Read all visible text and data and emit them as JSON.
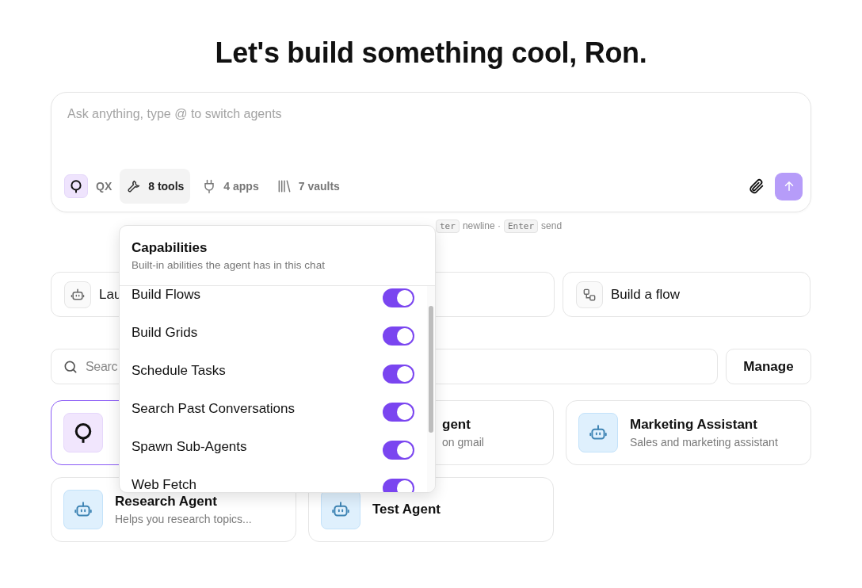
{
  "heading": "Let's build something cool, Ron.",
  "composer": {
    "placeholder": "Ask anything, type @ to switch agents",
    "agent": {
      "label": "QX"
    },
    "chips": [
      {
        "kind": "tools",
        "label": "8 tools",
        "selected": true
      },
      {
        "kind": "apps",
        "label": "4 apps",
        "selected": false
      },
      {
        "kind": "vaults",
        "label": "7 vaults",
        "selected": false
      }
    ],
    "send": {
      "disabled": true
    }
  },
  "hint": [
    {
      "kind": "key",
      "text": "ter"
    },
    {
      "kind": "text",
      "text": "newline ·"
    },
    {
      "kind": "key",
      "text": "Enter"
    },
    {
      "kind": "text",
      "text": "send"
    }
  ],
  "quick_actions": [
    {
      "kind": "agent",
      "label": "Lau"
    },
    {
      "kind": "blank"
    },
    {
      "kind": "flow",
      "label": "Build a flow"
    }
  ],
  "search": {
    "placeholder": "Searc"
  },
  "manage_button": "Manage",
  "agents": [
    {
      "kind": "logo",
      "selected": true
    },
    {
      "kind": "partial",
      "title": "gent",
      "subtitle": "on gmail",
      "selected": false
    },
    {
      "kind": "robot",
      "title": "Marketing Assistant",
      "subtitle": "Sales and marketing assistant",
      "selected": false
    },
    {
      "kind": "robot",
      "title": "Research Agent",
      "subtitle": "Helps you research topics...",
      "selected": false
    },
    {
      "kind": "robot",
      "title": "Test Agent",
      "selected": false
    }
  ],
  "capabilities": {
    "title": "Capabilities",
    "subtitle": "Built-in abilities the agent has in this chat",
    "items": [
      {
        "label": "Build Flows",
        "on": true
      },
      {
        "label": "Build Grids",
        "on": true
      },
      {
        "label": "Schedule Tasks",
        "on": true
      },
      {
        "label": "Search Past Conversations",
        "on": true
      },
      {
        "label": "Spawn Sub-Agents",
        "on": true
      },
      {
        "label": "Web Fetch",
        "on": true
      }
    ]
  }
}
